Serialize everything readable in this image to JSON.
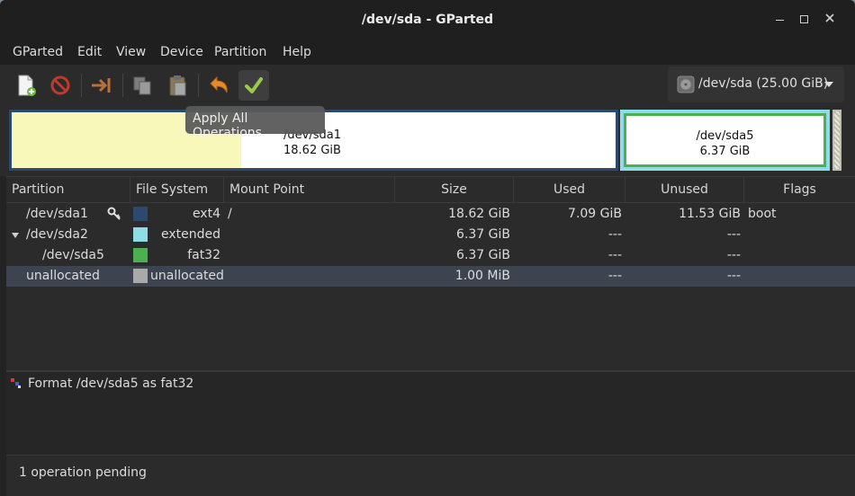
{
  "window": {
    "title": "/dev/sda - GParted"
  },
  "menu": [
    "GParted",
    "Edit",
    "View",
    "Device",
    "Partition",
    "Help"
  ],
  "toolbar": {
    "buttons": [
      {
        "icon": "new-partition-icon"
      },
      {
        "icon": "delete-icon"
      },
      {
        "icon": "resize-move-icon"
      },
      {
        "icon": "copy-icon"
      },
      {
        "icon": "paste-icon"
      },
      {
        "icon": "undo-icon"
      },
      {
        "icon": "apply-check-icon"
      }
    ],
    "tooltip": "Apply All Operations",
    "device_selector": "/dev/sda (25.00 GiB)"
  },
  "disk_map": {
    "sda1": {
      "name": "/dev/sda1",
      "size": "18.62 GiB",
      "used_fraction": 0.38
    },
    "sda5": {
      "name": "/dev/sda5",
      "size": "6.37 GiB"
    }
  },
  "table": {
    "columns": [
      "Partition",
      "File System",
      "Mount Point",
      "Size",
      "Used",
      "Unused",
      "Flags"
    ],
    "rows": [
      {
        "partition": "/dev/sda1",
        "filesystem": "ext4",
        "mount": "/",
        "size": "18.62 GiB",
        "used": "7.09 GiB",
        "unused": "11.53 GiB",
        "flags": "boot",
        "color": "#2c4a6e",
        "locked": true
      },
      {
        "partition": "/dev/sda2",
        "filesystem": "extended",
        "mount": "",
        "size": "6.37 GiB",
        "used": "---",
        "unused": "---",
        "flags": "",
        "color": "#8edde6"
      },
      {
        "partition": "/dev/sda5",
        "filesystem": "fat32",
        "mount": "",
        "size": "6.37 GiB",
        "used": "---",
        "unused": "---",
        "flags": "",
        "color": "#4caf50"
      },
      {
        "partition": "unallocated",
        "filesystem": "unallocated",
        "mount": "",
        "size": "1.00 MiB",
        "used": "---",
        "unused": "---",
        "flags": "",
        "color": "#a9a9a9"
      }
    ]
  },
  "operations": [
    "Format /dev/sda5 as fat32"
  ],
  "status": "1 operation pending"
}
